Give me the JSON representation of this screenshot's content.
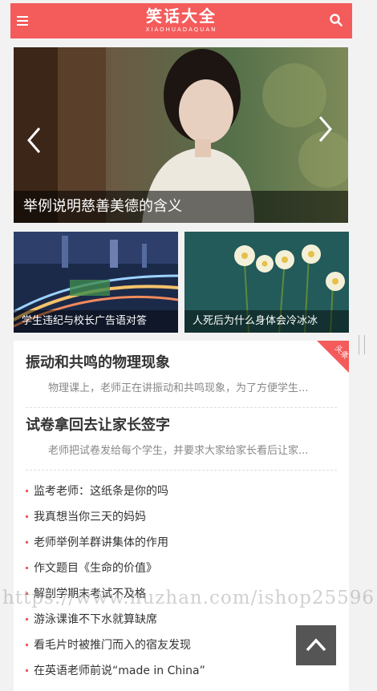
{
  "header": {
    "logo_text": "笑话大全",
    "logo_subtext": "XIAOHUADAQUAN",
    "menu_icon": "menu-icon",
    "search_icon": "search-icon"
  },
  "hero": {
    "caption": "举例说明慈善美德的含义",
    "prev_icon": "chevron-left-icon",
    "next_icon": "chevron-right-icon"
  },
  "thumbnails": [
    {
      "caption": "学生违纪与校长广告语对答"
    },
    {
      "caption": "人死后为什么身体会冷冰冰"
    }
  ],
  "card": {
    "ribbon_label": "头条",
    "featured": [
      {
        "title": "振动和共鸣的物理现象",
        "summary": "物理课上，老师正在讲振动和共鸣现象，为了方便学生..."
      },
      {
        "title": "试卷拿回去让家长签字",
        "summary": "老师把试卷发给每个学生，并要求大家给家长看后让家..."
      }
    ],
    "list": [
      "监考老师：这纸条是你的吗",
      "我真想当你三天的妈妈",
      "老师举例羊群讲集体的作用",
      "作文题目《生命的价值》",
      "解剖学期末考试不及格",
      "游泳课谁不下水就算缺席",
      "看毛片时被推门而入的宿友发现",
      "在英语老师前说“made in China”"
    ]
  },
  "watermark": "https://www.huzhan.com/ishop25596",
  "back_to_top_icon": "arrow-up-icon",
  "colors": {
    "accent": "#f45b5b"
  }
}
